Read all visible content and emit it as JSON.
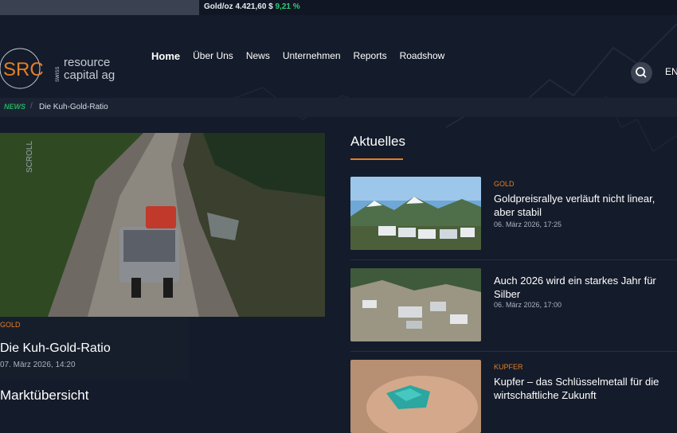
{
  "ticker": {
    "label": "Gold/oz",
    "price": "4.421,60 $",
    "change": "9,21 %"
  },
  "logo": {
    "mark": "SRC",
    "swiss": "SWISS",
    "line1": "resource",
    "line2": "capital ag"
  },
  "nav": {
    "items": [
      {
        "label": "Home"
      },
      {
        "label": "Über Uns"
      },
      {
        "label": "News"
      },
      {
        "label": "Unternehmen"
      },
      {
        "label": "Reports"
      },
      {
        "label": "Roadshow"
      }
    ],
    "lang": "EN"
  },
  "breadcrumb": {
    "section": "NEWS",
    "current": "Die Kuh-Gold-Ratio"
  },
  "hero": {
    "category": "GOLD",
    "title": "Die Kuh-Gold-Ratio",
    "date": "07. März 2026, 14:20",
    "overlay_text": "SCROLL"
  },
  "market": {
    "heading": "Marktübersicht"
  },
  "aktuelles": {
    "heading": "Aktuelles",
    "items": [
      {
        "category": "GOLD",
        "title": "Goldpreisrallye verläuft nicht linear, aber stabil",
        "date": "06. März 2026, 17:25"
      },
      {
        "category": "",
        "title": "Auch 2026 wird ein starkes Jahr für Silber",
        "date": "06. März 2026, 17:00"
      },
      {
        "category": "KUPFER",
        "title": "Kupfer – das Schlüsselmetall für die wirtschaftliche Zukunft",
        "date": ""
      }
    ]
  },
  "colors": {
    "accent": "#e67e22",
    "positive": "#2ecc71",
    "news_green": "#27ae60",
    "background": "#141b2a"
  }
}
